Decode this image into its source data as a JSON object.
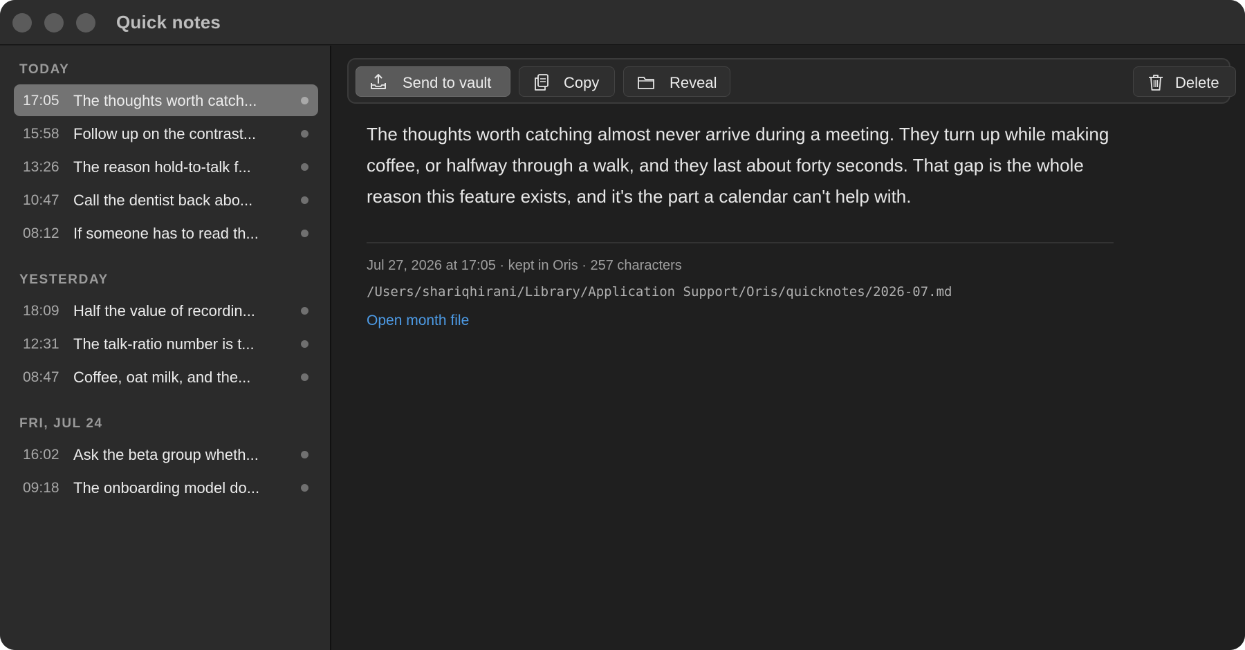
{
  "window": {
    "title": "Quick notes"
  },
  "sidebar": {
    "groups": [
      {
        "header": "TODAY",
        "items": [
          {
            "time": "17:05",
            "title": "The thoughts worth catch...",
            "selected": true
          },
          {
            "time": "15:58",
            "title": "Follow up on the contrast..."
          },
          {
            "time": "13:26",
            "title": "The reason hold-to-talk f..."
          },
          {
            "time": "10:47",
            "title": "Call the dentist back abo..."
          },
          {
            "time": "08:12",
            "title": "If someone has to read th..."
          }
        ]
      },
      {
        "header": "YESTERDAY",
        "items": [
          {
            "time": "18:09",
            "title": "Half the value of recordin..."
          },
          {
            "time": "12:31",
            "title": "The talk-ratio number is t..."
          },
          {
            "time": "08:47",
            "title": "Coffee, oat milk, and the..."
          }
        ]
      },
      {
        "header": "FRI, JUL 24",
        "items": [
          {
            "time": "16:02",
            "title": "Ask the beta group wheth..."
          },
          {
            "time": "09:18",
            "title": "The onboarding model do..."
          }
        ]
      }
    ]
  },
  "toolbar": {
    "send_label": "Send to vault",
    "send_icon": "upload-tray-icon",
    "copy_label": "Copy",
    "copy_icon": "copy-icon",
    "reveal_label": "Reveal",
    "reveal_icon": "folder-icon",
    "delete_label": "Delete",
    "delete_icon": "trash-icon"
  },
  "note": {
    "body": "The thoughts worth catching almost never arrive during a meeting. They turn up while making coffee, or halfway through a walk, and they last about forty seconds. That gap is the whole reason this feature exists, and it's the part a calendar can't help with.",
    "meta": "Jul 27, 2026 at 17:05 · kept in Oris · 257 characters",
    "path": "/Users/shariqhirani/Library/Application Support/Oris/quicknotes/2026-07.md",
    "open_link": "Open month file"
  },
  "colors": {
    "window_bg": "#1f1f1f",
    "sidebar_bg": "#2b2b2b",
    "selection": "#737373",
    "link": "#4d9be6"
  }
}
